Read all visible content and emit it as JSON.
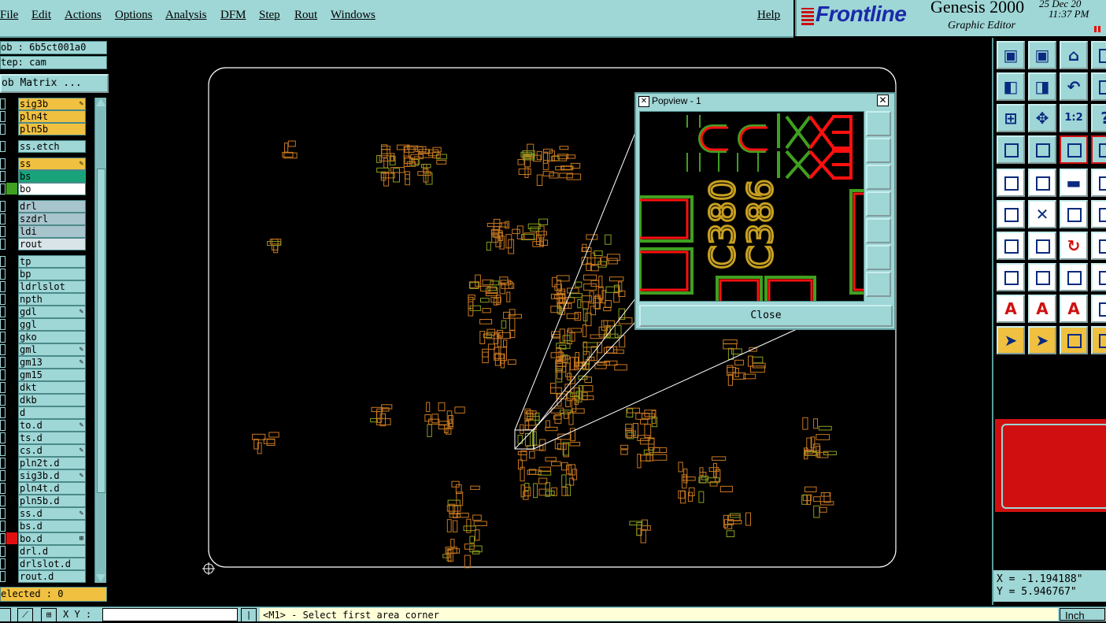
{
  "menubar": {
    "items": [
      "File",
      "Edit",
      "Actions",
      "Options",
      "Analysis",
      "DFM",
      "Step",
      "Rout",
      "Windows"
    ],
    "help": "Help"
  },
  "brand": {
    "logo": "Frontline",
    "product": "Genesis 2000",
    "subtitle": "Graphic Editor",
    "date": "25 Dec 20",
    "time": "11:37 PM"
  },
  "job": {
    "job_line": "ob : 6b5ct001a0",
    "step_line": "tep: cam",
    "matrix_button": "ob Matrix ...",
    "selected": "elected : 0"
  },
  "layers": [
    {
      "name": "sig3b",
      "color": "#f0c040",
      "mark": "✎"
    },
    {
      "name": "pln4t",
      "color": "#f0c040",
      "mark": ""
    },
    {
      "name": "pln5b",
      "color": "#f0c040",
      "mark": ""
    },
    {
      "name": "ss.etch",
      "color": "#9fd6d6",
      "mark": ""
    },
    {
      "name": "ss",
      "color": "#f0c040",
      "mark": "✎"
    },
    {
      "name": "bs",
      "color": "#1aa37a",
      "mark": ""
    },
    {
      "name": "bo",
      "color": "#ffffff",
      "mark": "",
      "swatch": "#40a020"
    },
    {
      "name": "drl",
      "color": "#a8c4cc",
      "mark": ""
    },
    {
      "name": "szdrl",
      "color": "#a8c4cc",
      "mark": ""
    },
    {
      "name": "ldi",
      "color": "#a8c4cc",
      "mark": ""
    },
    {
      "name": "rout",
      "color": "#d8e4e8",
      "mark": ""
    },
    {
      "name": "tp",
      "color": "#9fd6d6",
      "mark": ""
    },
    {
      "name": "bp",
      "color": "#9fd6d6",
      "mark": ""
    },
    {
      "name": "ldrlslot",
      "color": "#9fd6d6",
      "mark": ""
    },
    {
      "name": "npth",
      "color": "#9fd6d6",
      "mark": ""
    },
    {
      "name": "gdl",
      "color": "#9fd6d6",
      "mark": "✎"
    },
    {
      "name": "ggl",
      "color": "#9fd6d6",
      "mark": ""
    },
    {
      "name": "gko",
      "color": "#9fd6d6",
      "mark": ""
    },
    {
      "name": "gml",
      "color": "#9fd6d6",
      "mark": "✎"
    },
    {
      "name": "gm13",
      "color": "#9fd6d6",
      "mark": "✎"
    },
    {
      "name": "gm15",
      "color": "#9fd6d6",
      "mark": ""
    },
    {
      "name": "dkt",
      "color": "#9fd6d6",
      "mark": ""
    },
    {
      "name": "dkb",
      "color": "#9fd6d6",
      "mark": ""
    },
    {
      "name": "d",
      "color": "#9fd6d6",
      "mark": ""
    },
    {
      "name": "to.d",
      "color": "#9fd6d6",
      "mark": "✎"
    },
    {
      "name": "ts.d",
      "color": "#9fd6d6",
      "mark": ""
    },
    {
      "name": "cs.d",
      "color": "#9fd6d6",
      "mark": "✎"
    },
    {
      "name": "pln2t.d",
      "color": "#9fd6d6",
      "mark": ""
    },
    {
      "name": "sig3b.d",
      "color": "#9fd6d6",
      "mark": "✎"
    },
    {
      "name": "pln4t.d",
      "color": "#9fd6d6",
      "mark": ""
    },
    {
      "name": "pln5b.d",
      "color": "#9fd6d6",
      "mark": ""
    },
    {
      "name": "ss.d",
      "color": "#9fd6d6",
      "mark": "✎"
    },
    {
      "name": "bs.d",
      "color": "#9fd6d6",
      "mark": ""
    },
    {
      "name": "bo.d",
      "color": "#9fd6d6",
      "mark": "⊞",
      "swatch": "#e01010"
    },
    {
      "name": "drl.d",
      "color": "#9fd6d6",
      "mark": ""
    },
    {
      "name": "drlslot.d",
      "color": "#9fd6d6",
      "mark": ""
    },
    {
      "name": "rout.d",
      "color": "#9fd6d6",
      "mark": ""
    }
  ],
  "popview": {
    "title": "Popview - 1",
    "close_label": "Close",
    "labels": [
      "C380",
      "C386"
    ]
  },
  "coords": {
    "x": "X = -1.194188\"",
    "y": "Y = 5.946767\""
  },
  "statusbar": {
    "xy_label": "X Y :",
    "xy_value": "",
    "prompt": "<M1> - Select first area corner",
    "units": "Inch"
  },
  "colors": {
    "panel": "#9fd6d6",
    "active_layer": "#f0c040",
    "board_outline": "#ffffff",
    "pad": "#c87820",
    "silk": "#8aa020",
    "popview_red": "#ff1010",
    "popview_green": "#40a020",
    "popview_label": "#c8a020"
  }
}
